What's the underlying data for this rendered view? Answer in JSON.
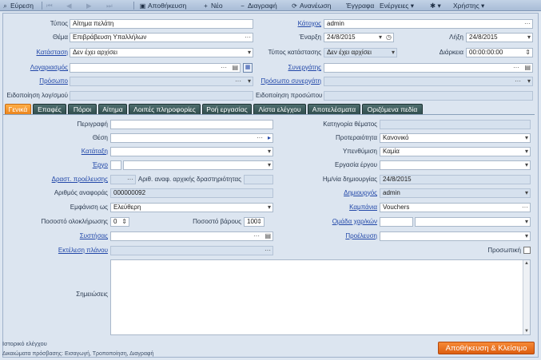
{
  "toolbar": {
    "search": "Εύρεση",
    "save": "Αποθήκευση",
    "new": "Νέο",
    "delete": "Διαγραφή",
    "refresh": "Ανανέωση",
    "document": "Έγγραφα",
    "actions": "Ενέργειες",
    "users": "Χρήστης"
  },
  "header": {
    "type_label": "Τύπος",
    "type_value": "Αίτημα πελάτη",
    "subject_label": "Θέμα",
    "subject_value": "Επιβράβευση Υπαλλήλων",
    "status_label": "Κατάσταση",
    "status_value": "Δεν έχει αρχίσει",
    "account_label": "Λογαριασμός",
    "account_value": "",
    "contact_label": "Πρόσωπο",
    "contact_value": "",
    "notify_account_label": "Ειδοποίηση λογ/σμού",
    "owner_label": "Κάτοχος",
    "owner_value": "admin",
    "start_label": "Έναρξη",
    "start_value": "24/8/2015",
    "end_label": "Λήξη",
    "end_value": "24/8/2015",
    "status_type_label": "Τύπος κατάστασης",
    "status_type_value": "Δεν έχει αρχίσει",
    "duration_label": "Διάρκεια",
    "duration_value": "00:00:00:00",
    "partner_label": "Συνεργάτης",
    "partner_value": "",
    "partner_contact_label": "Πρόσωπο συνεργάτη",
    "partner_contact_value": "",
    "notify_contact_label": "Ειδοποίηση προσώπου"
  },
  "tabs": [
    "Γενικά",
    "Επαφές",
    "Πόροι",
    "Αίτημα",
    "Λοιπές πληροφορίες",
    "Ροή εργασίας",
    "Λίστα ελέγχου",
    "Αποτελέσματα",
    "Οριζόμενα πεδία"
  ],
  "general": {
    "description_label": "Περιγραφή",
    "position_label": "Θέση",
    "classification_label": "Κατάταξη",
    "project_label": "Έργο",
    "predecessor_label": "Δραστ. προέλευσης",
    "origin_num_label": "Αριθ. αναφ. αρχικής δραστηριότητας",
    "ref_num_label": "Αριθμός αναφοράς",
    "ref_num_value": "000000092",
    "display_as_label": "Εμφάνιση ως",
    "display_as_value": "Ελεύθερη",
    "completion_label": "Ποσοστό ολοκλήρωσης",
    "completion_value": "0",
    "weight_label": "Ποσοστό βάρους",
    "weight_value": "100",
    "recommendation_label": "Συστήσας",
    "plan_label": "Εκτέλεση πλάνου",
    "notes_label": "Σημειώσεις",
    "category_label": "Κατηγορία θέματος",
    "priority_label": "Προτεραιότητα",
    "priority_value": "Κανονικό",
    "reminder_label": "Υπενθύμιση",
    "reminder_value": "Καμία",
    "project_task_label": "Εργασία έργου",
    "created_date_label": "Ημ/νία δημιουργίας",
    "created_date_value": "24/8/2015",
    "creator_label": "Δημιουργός",
    "creator_value": "admin",
    "campaign_label": "Καμπάνια",
    "campaign_value": "Vouchers",
    "char_group_label": "Ομάδα χαρ/κών",
    "origin_label": "Προέλευση",
    "private_label": "Προσωπική"
  },
  "footer": {
    "audit_label": "Ιστορικό ελέγχου",
    "rights_label": "Δικαιώματα πρόσβασης: Εισαγωγή, Τροποποίηση, Διαγραφή",
    "save_close": "Αποθήκευση & Κλείσιμο"
  }
}
